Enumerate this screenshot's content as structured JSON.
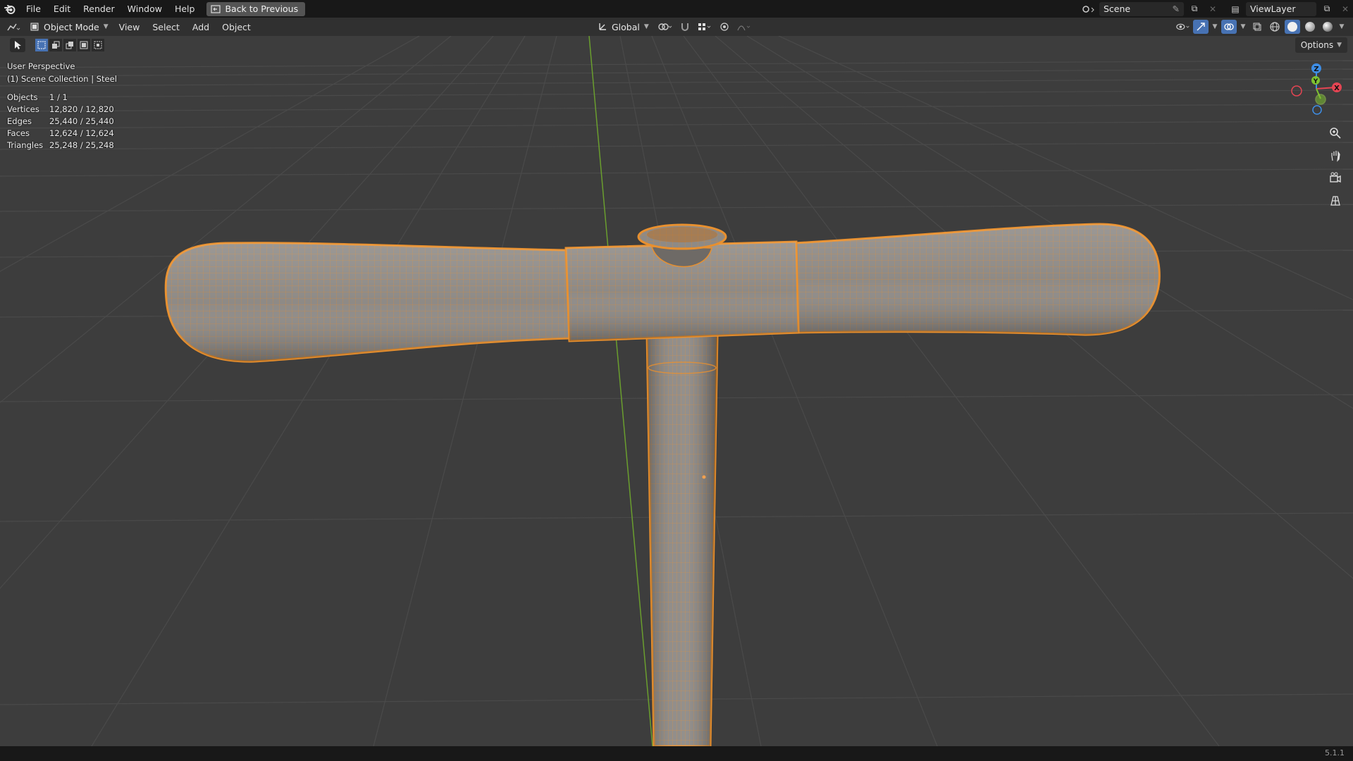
{
  "menu": {
    "items": [
      "File",
      "Edit",
      "Render",
      "Window",
      "Help"
    ],
    "back_button": "Back to Previous"
  },
  "top_right": {
    "scene": "Scene",
    "view_layer": "ViewLayer"
  },
  "header": {
    "mode": "Object Mode",
    "menus": [
      "View",
      "Select",
      "Add",
      "Object"
    ],
    "transform_orientation": "Global",
    "options": "Options"
  },
  "viewport": {
    "perspective": "User Perspective",
    "collection": "(1) Scene Collection | Steel",
    "stats": [
      {
        "label": "Objects",
        "value": "1 / 1"
      },
      {
        "label": "Vertices",
        "value": "12,820 / 12,820"
      },
      {
        "label": "Edges",
        "value": "25,440 / 25,440"
      },
      {
        "label": "Faces",
        "value": "12,624 / 12,624"
      },
      {
        "label": "Triangles",
        "value": "25,248 / 25,248"
      }
    ],
    "gizmo": {
      "x": "X",
      "y": "Y",
      "z": "Z"
    }
  },
  "status": {
    "version": "5.1.1"
  },
  "colors": {
    "selection": "#e8902f",
    "axis_x": "#e54553",
    "axis_y": "#7ec230",
    "axis_z": "#3e8ee6",
    "grid": "#4a4a4a",
    "viewport_bg": "#3d3d3d"
  }
}
